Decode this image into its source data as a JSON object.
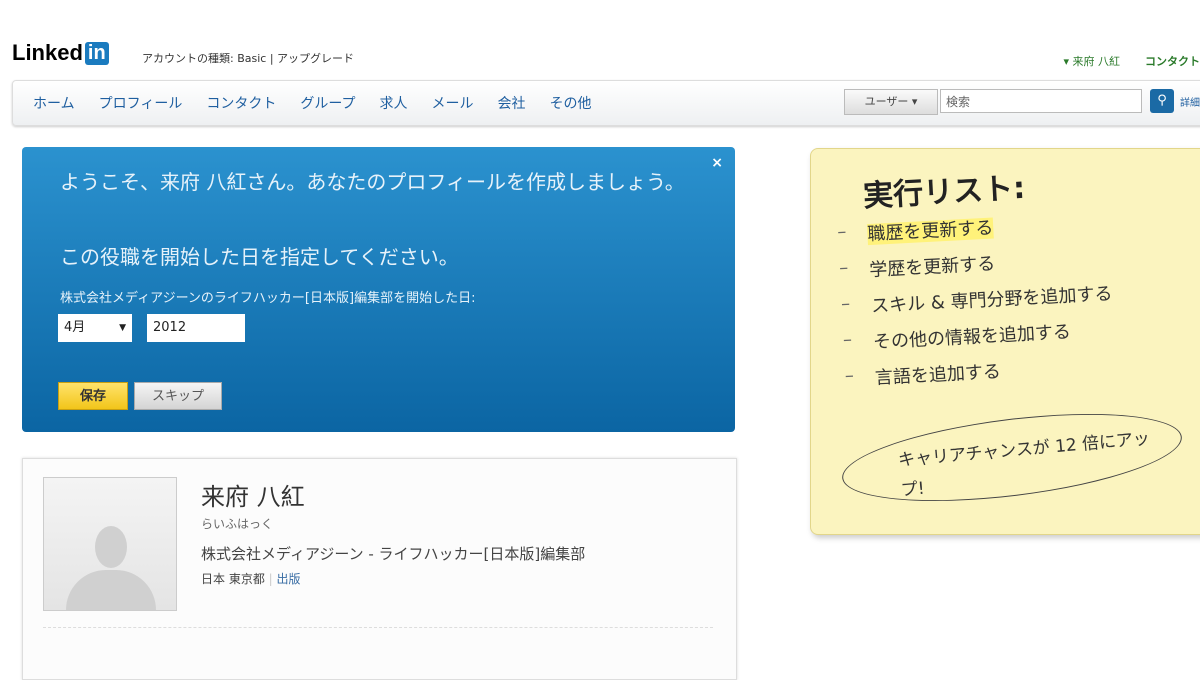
{
  "header": {
    "logo_text": "Linked",
    "logo_in": "in",
    "account": "アカウントの種類: Basic | アップグレード",
    "user_name": "▾ 来府 八紅",
    "contacts": "コンタクト"
  },
  "nav": {
    "items": [
      "ホーム",
      "プロフィール",
      "コンタクト",
      "グループ",
      "求人",
      "メール",
      "会社",
      "その他"
    ]
  },
  "search": {
    "scope": "ユーザー ▾",
    "placeholder": "検索",
    "advanced": "詳細"
  },
  "welcome": {
    "title": "ようこそ、来府 八紅さん。あなたのプロフィールを作成しましょう。",
    "prompt": "この役職を開始した日を指定してください。",
    "label": "株式会社メディアジーンのライフハッカー[日本版]編集部を開始した日:",
    "month": "4月",
    "year": "2012",
    "save": "保存",
    "skip": "スキップ",
    "close": "×"
  },
  "profile": {
    "name": "来府 八紅",
    "kana": "らいふはっく",
    "title": "株式会社メディアジーン - ライフハッカー[日本版]編集部",
    "location": "日本 東京都",
    "industry": "出版"
  },
  "todo": {
    "heading": "実行リスト:",
    "items": [
      "職歴を更新する",
      "学歴を更新する",
      "スキル & 専門分野を追加する",
      "その他の情報を追加する",
      "言語を追加する"
    ],
    "bonus": "キャリアチャンスが 12 倍にアップ!"
  }
}
